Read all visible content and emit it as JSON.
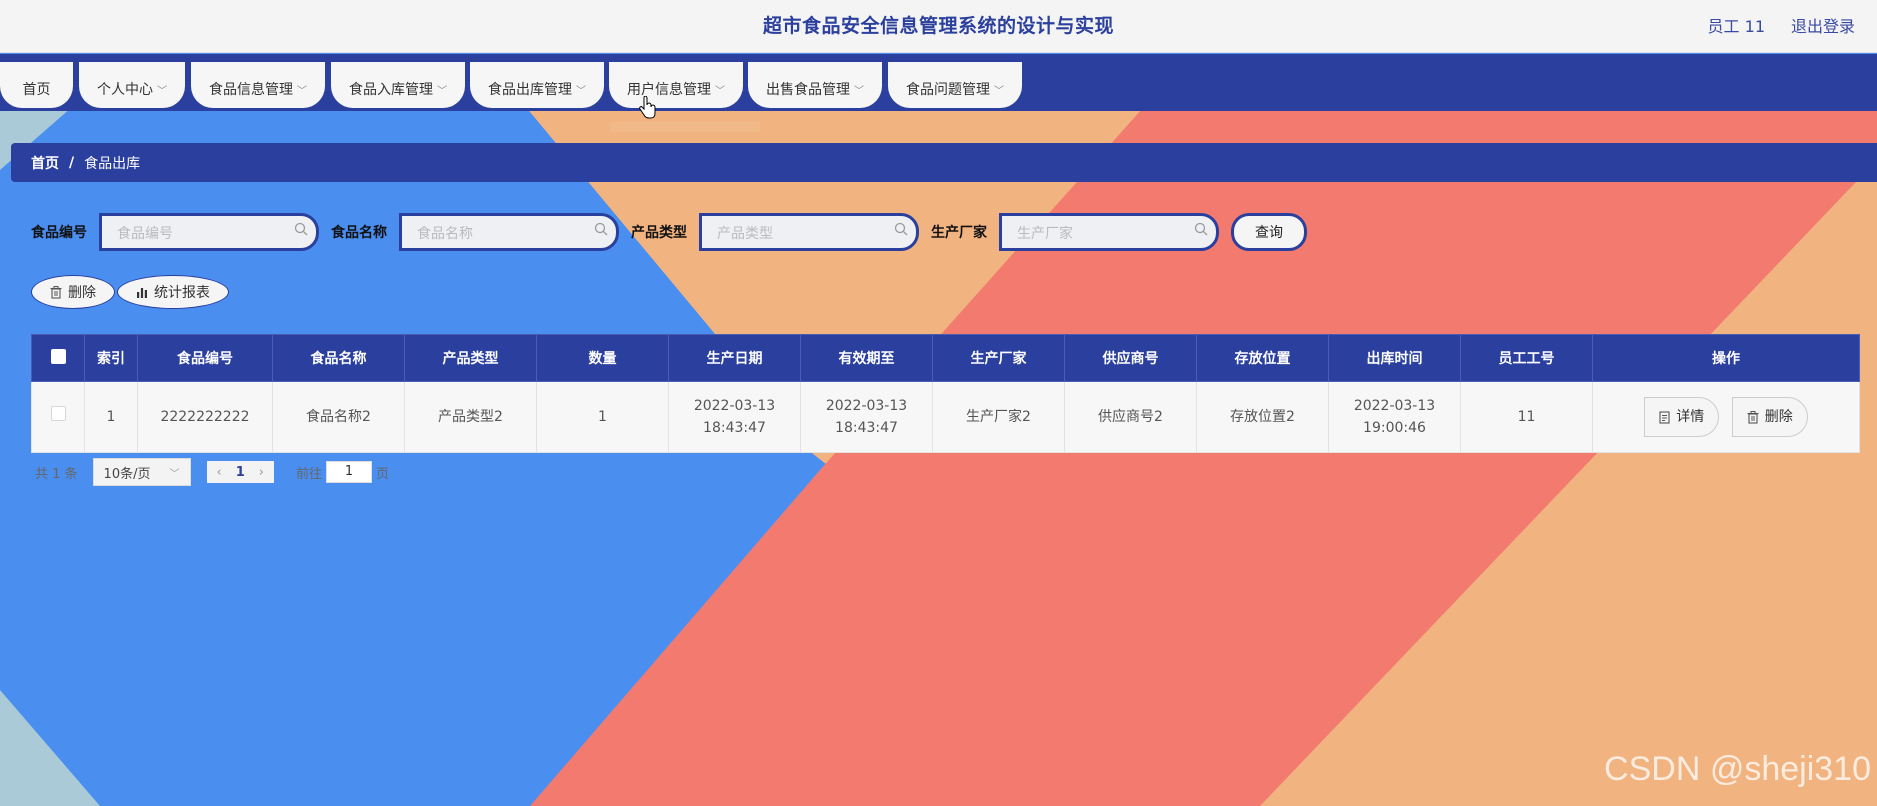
{
  "colors": {
    "accent": "#2a3f9e",
    "blue": "#4a8ef0",
    "orange": "#f1b380",
    "salmon": "#f27a6e",
    "teal": "#a9cad6"
  },
  "header": {
    "title": "超市食品安全信息管理系统的设计与实现",
    "user": "员工 11",
    "logout": "退出登录"
  },
  "nav": [
    {
      "label": "首页"
    },
    {
      "label": "个人中心"
    },
    {
      "label": "食品信息管理"
    },
    {
      "label": "食品入库管理"
    },
    {
      "label": "食品出库管理"
    },
    {
      "label": "用户信息管理"
    },
    {
      "label": "出售食品管理"
    },
    {
      "label": "食品问题管理"
    }
  ],
  "breadcrumb": {
    "home": "首页",
    "sep": "/",
    "current": "食品出库"
  },
  "search": {
    "fields": [
      {
        "label": "食品编号",
        "placeholder": "食品编号"
      },
      {
        "label": "食品名称",
        "placeholder": "食品名称"
      },
      {
        "label": "产品类型",
        "placeholder": "产品类型"
      },
      {
        "label": "生产厂家",
        "placeholder": "生产厂家"
      }
    ],
    "query_label": "查询"
  },
  "actions": {
    "delete": "删除",
    "report": "统计报表"
  },
  "table": {
    "headers": [
      "索引",
      "食品编号",
      "食品名称",
      "产品类型",
      "数量",
      "生产日期",
      "有效期至",
      "生产厂家",
      "供应商号",
      "存放位置",
      "出库时间",
      "员工工号",
      "操作"
    ],
    "rows": [
      {
        "index": "1",
        "code": "2222222222",
        "name": "食品名称2",
        "type": "产品类型2",
        "qty": "1",
        "prod_date": "2022-03-13 18:43:47",
        "expire": "2022-03-13 18:43:47",
        "maker": "生产厂家2",
        "supplier": "供应商号2",
        "location": "存放位置2",
        "out_time": "2022-03-13 19:00:46",
        "staff": "11",
        "detail": "详情",
        "delete": "删除"
      }
    ]
  },
  "pager": {
    "total": "共 1 条",
    "page_size": "10条/页",
    "current": "1",
    "goto": "前往",
    "goto_value": "1",
    "page_unit": "页"
  },
  "watermark": "CSDN @sheji310"
}
